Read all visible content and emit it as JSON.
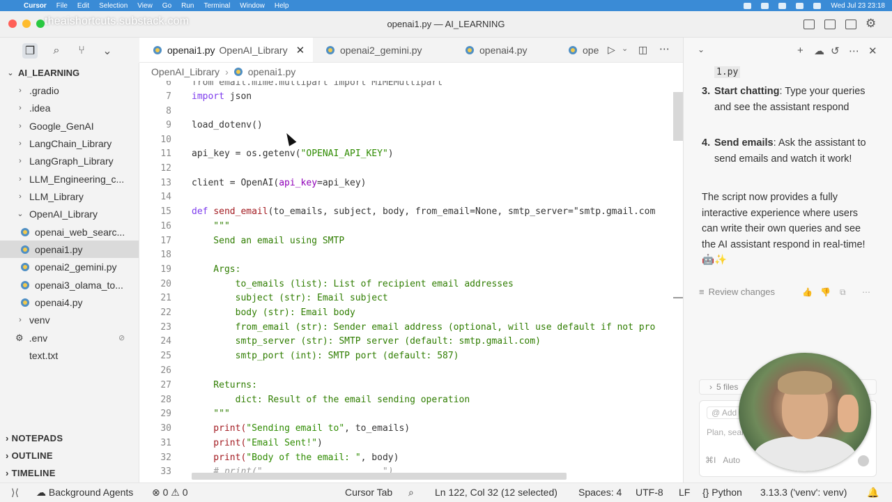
{
  "menubar": {
    "app": "Cursor",
    "items": [
      "File",
      "Edit",
      "Selection",
      "View",
      "Go",
      "Run",
      "Terminal",
      "Window",
      "Help"
    ],
    "datetime": "Wed Jul 23  23:18"
  },
  "window": {
    "title": "openai1.py — AI_LEARNING",
    "overlay_text": "theaishortcuts.substack.com"
  },
  "explorer": {
    "root": "AI_LEARNING",
    "items": [
      ".gradio",
      ".idea",
      "Google_GenAI",
      "LangChain_Library",
      "LangGraph_Library",
      "LLM_Engineering_c...",
      "LLM_Library",
      "OpenAI_Library",
      "openai_web_searc...",
      "openai1.py",
      "openai2_gemini.py",
      "openai3_olama_to...",
      "openai4.py",
      "venv",
      ".env",
      "text.txt"
    ],
    "sections": [
      "NOTEPADS",
      "OUTLINE",
      "TIMELINE"
    ]
  },
  "tabs": [
    {
      "label": "openai1.py",
      "desc": "OpenAI_Library"
    },
    {
      "label": "openai2_gemini.py"
    },
    {
      "label": "openai4.py"
    },
    {
      "label": "ope"
    }
  ],
  "breadcrumb": {
    "folder": "OpenAI_Library",
    "file": "openai1.py"
  },
  "code": {
    "line_numbers": [
      "6",
      "7",
      "8",
      "9",
      "10",
      "11",
      "12",
      "13",
      "14",
      "15",
      "16",
      "17",
      "18",
      "19",
      "20",
      "21",
      "22",
      "23",
      "24",
      "25",
      "26",
      "27",
      "28",
      "29",
      "30",
      "31",
      "32",
      "33"
    ],
    "l6": "from email.mime.multipart import MIMEMultipart",
    "l7a": "import",
    "l7b": " json",
    "l9": "load_dotenv()",
    "l11a": "api_key = os.getenv(",
    "l11b": "\"OPENAI_API_KEY\"",
    "l11c": ")",
    "l13a": "client = OpenAI(",
    "l13b": "api_key",
    "l13c": "=api_key)",
    "l15a": "def ",
    "l15b": "send_email",
    "l15c": "(to_emails, subject, body, from_email=None, smtp_server=\"smtp.gmail.com",
    "l16": "    \"\"\"",
    "l17": "    Send an email using SMTP",
    "l19": "    Args:",
    "l20": "        to_emails (list): List of recipient email addresses",
    "l21": "        subject (str): Email subject",
    "l22": "        body (str): Email body",
    "l23": "        from_email (str): Sender email address (optional, will use default if not pro",
    "l24": "        smtp_server (str): SMTP server (default: smtp.gmail.com)",
    "l25": "        smtp_port (int): SMTP port (default: 587)",
    "l27": "    Returns:",
    "l28": "        dict: Result of the email sending operation",
    "l29": "    \"\"\"",
    "l30a": "    print(",
    "l30b": "\"Sending email to\"",
    "l30c": ", to_emails)",
    "l31a": "    print(",
    "l31b": "\"Email Sent!\"",
    "l31c": ")",
    "l32a": "    print(",
    "l32b": "\"Body of the email: \"",
    "l32c": ", body)",
    "l33": "    # print(\"______________________\")"
  },
  "chat": {
    "file_ref": "1.py",
    "item3_num": "3.",
    "item3_bold": "Start chatting",
    "item3_text": ": Type your queries and see the assistant respond",
    "item4_num": "4.",
    "item4_bold": "Send emails",
    "item4_text": ": Ask the assistant to send emails and watch it work!",
    "summary": "The script now provides a fully interactive experience where users can write their own queries and see the AI assistant respond in real-time! 🤖✨",
    "review": "Review changes",
    "files": "5 files",
    "add_context": "Add C",
    "placeholder": "Plan, sear",
    "shortcut": "⌘I",
    "model": "Auto"
  },
  "statusbar": {
    "agents": "Background Agents",
    "errors": "0",
    "warnings": "0",
    "cursor_tab": "Cursor Tab",
    "position": "Ln 122, Col 32 (12 selected)",
    "spaces": "Spaces: 4",
    "encoding": "UTF-8",
    "eol": "LF",
    "language": "Python",
    "interpreter": "3.13.3 ('venv': venv)"
  },
  "colors": {
    "menubar": "#3a8bd6",
    "keyword": "#7c3aed",
    "function": "#a2191f",
    "string": "#2e8b00"
  }
}
